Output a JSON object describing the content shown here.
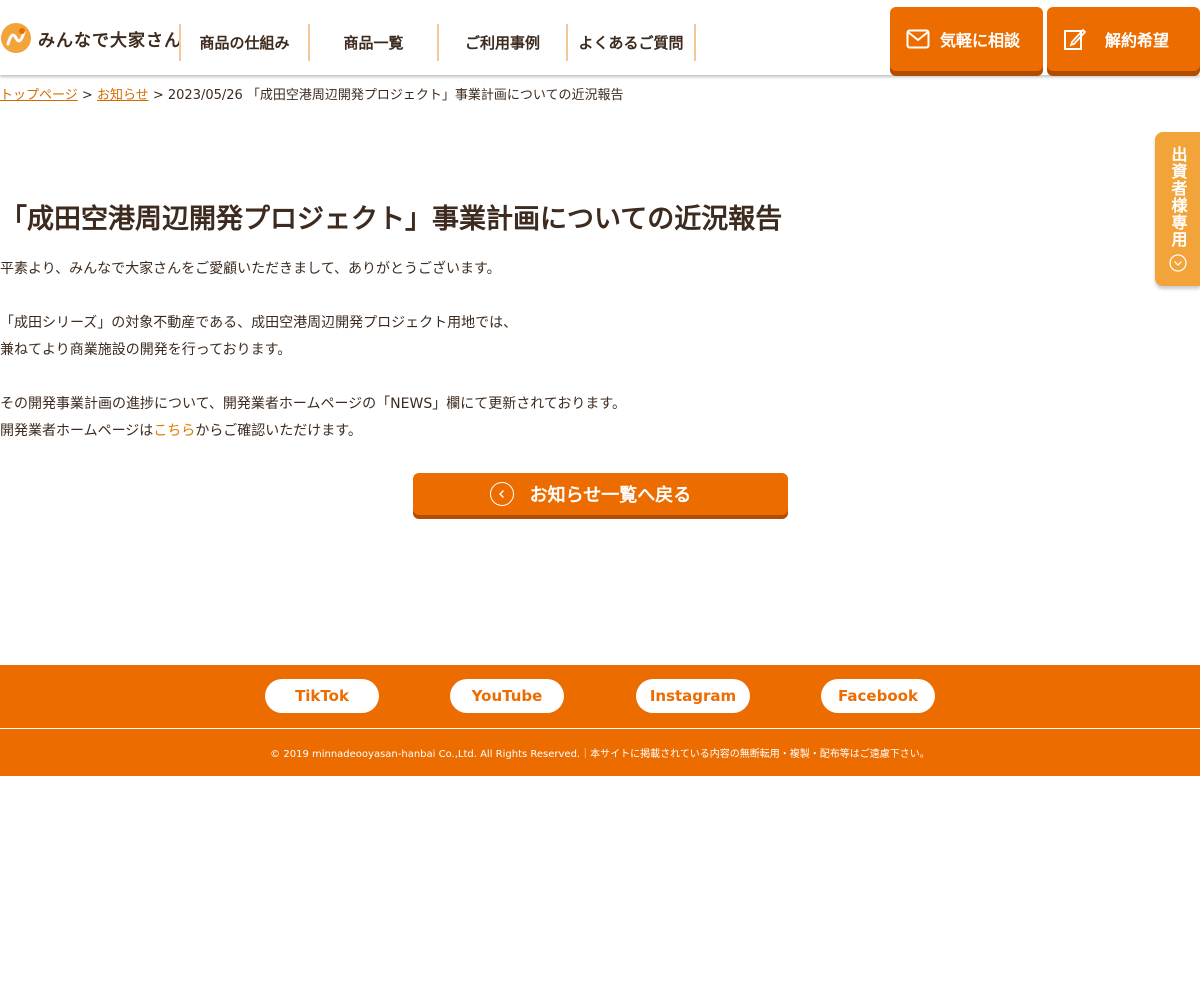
{
  "header": {
    "logo_text": "みんなで大家さん",
    "nav": [
      {
        "label": "商品の仕組み"
      },
      {
        "label": "商品一覧"
      },
      {
        "label": "ご利用事例"
      },
      {
        "label": "よくあるご質問"
      }
    ],
    "consult_label": "気軽に相談",
    "cancel_label": "解約希望"
  },
  "breadcrumb": {
    "home": "トップページ",
    "sep": ">",
    "news": "お知らせ",
    "current": "2023/05/26 「成田空港周辺開発プロジェクト」事業計画についての近況報告"
  },
  "sidetab": {
    "label": "出資者様専用"
  },
  "article": {
    "title": "「成田空港周辺開発プロジェクト」事業計画についての近況報告",
    "p1": "平素より、みんなで大家さんをご愛顧いただきまして、ありがとうございます。",
    "p2a": "「成田シリーズ」の対象不動産である、成田空港周辺開発プロジェクト用地では、",
    "p2b": "兼ねてより商業施設の開発を行っております。",
    "p3a": "その開発事業計画の進捗について、開発業者ホームページの「NEWS」欄にて更新されております。",
    "p3b_pre": "開発業者ホームページは",
    "p3b_link": "こちら",
    "p3b_post": "からご確認いただけます。",
    "back_label": "お知らせ一覧へ戻る"
  },
  "footer": {
    "sns": [
      {
        "label": "TikTok"
      },
      {
        "label": "YouTube"
      },
      {
        "label": "Instagram"
      },
      {
        "label": "Facebook"
      }
    ],
    "copyright": "© 2019 minnadeooyasan-hanbai Co.,Ltd. All Rights Reserved.｜本サイトに掲載されている内容の無断転用・複製・配布等はご遠慮下さい。"
  },
  "colors": {
    "brand": "#ec6c00",
    "brand_dark": "#b24c00",
    "text": "#3d2b1f",
    "sidetab": "#f2a33a"
  }
}
